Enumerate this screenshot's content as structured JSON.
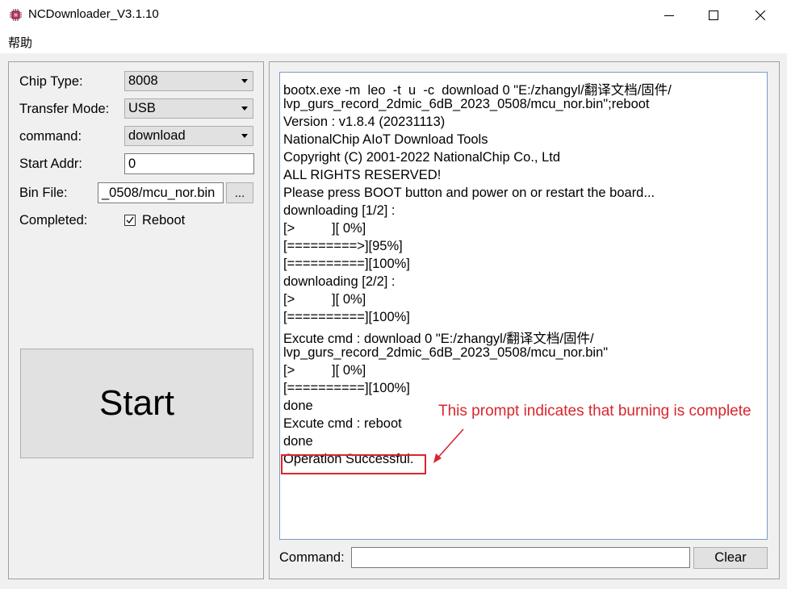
{
  "window": {
    "title": "NCDownloader_V3.1.10",
    "minimize_icon": "minimize-icon",
    "maximize_icon": "maximize-icon",
    "close_icon": "close-icon",
    "app_icon": "chip-icon"
  },
  "menu": {
    "help_label": "帮助"
  },
  "settings": {
    "chip_type": {
      "label": "Chip Type:",
      "value": "8008"
    },
    "transfer_mode": {
      "label": "Transfer Mode:",
      "value": "USB"
    },
    "command": {
      "label": "command:",
      "value": "download"
    },
    "start_addr": {
      "label": "Start Addr:",
      "value": "0"
    },
    "bin_file": {
      "label": "Bin File:",
      "value": "_0508/mcu_nor.bin",
      "browse_label": "..."
    },
    "completed": {
      "label": "Completed:",
      "reboot_label": "Reboot",
      "reboot_checked": true
    }
  },
  "start_button": {
    "label": "Start"
  },
  "log": {
    "lines": [
      "bootx.exe -m  leo  -t  u  -c  download 0 \"E:/zhangyl/翻译文档/固件/",
      "lvp_gurs_record_2dmic_6dB_2023_0508/mcu_nor.bin\";reboot",
      "Version : v1.8.4 (20231113)",
      "NationalChip AIoT Download Tools",
      "Copyright (C) 2001-2022 NationalChip Co., Ltd",
      "ALL RIGHTS RESERVED!",
      "Please press BOOT button and power on or restart the board...",
      "downloading [1/2] :",
      "[>          ][ 0%]",
      "[=========>][95%]",
      "[==========][100%]",
      "downloading [2/2] :",
      "[>          ][ 0%]",
      "[==========][100%]",
      "Excute cmd : download 0 \"E:/zhangyl/翻译文档/固件/",
      "lvp_gurs_record_2dmic_6dB_2023_0508/mcu_nor.bin\"",
      "[>          ][ 0%]",
      "[==========][100%]",
      "done",
      "Excute cmd : reboot",
      "done",
      "Operation Successful."
    ]
  },
  "annotation": {
    "text": "This prompt indicates that burning is complete",
    "color": "#d9262d"
  },
  "command_bar": {
    "label": "Command:",
    "value": "",
    "clear_label": "Clear"
  }
}
